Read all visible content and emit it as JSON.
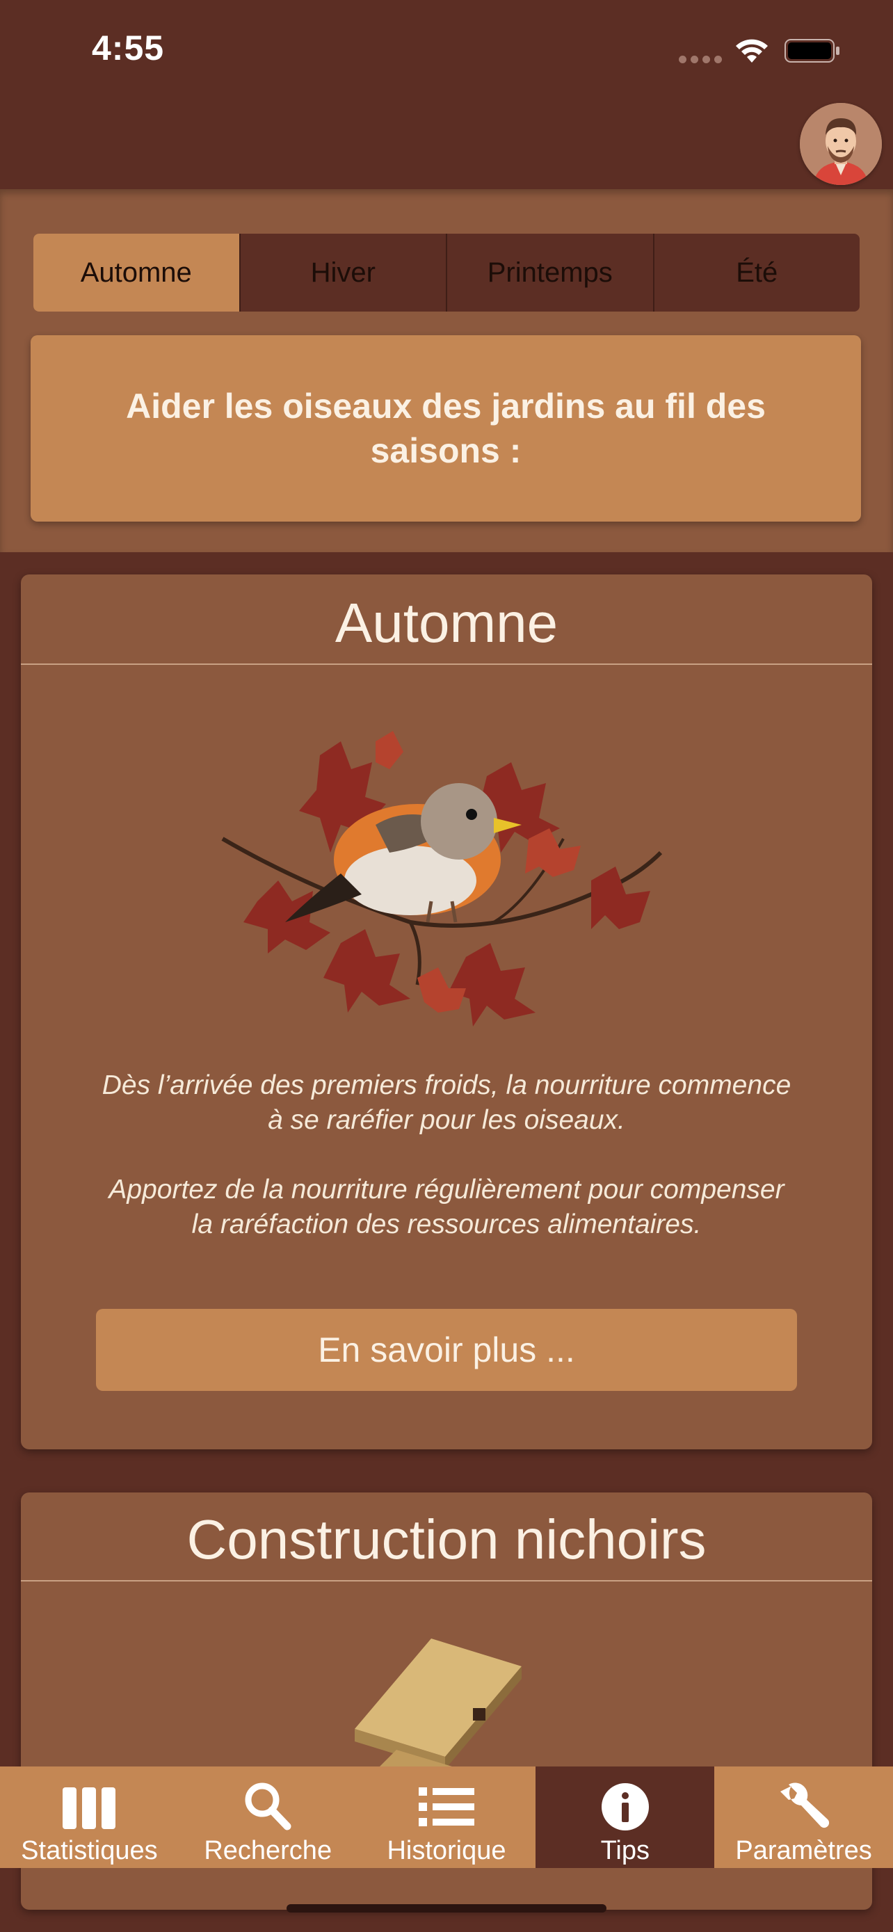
{
  "status_bar": {
    "time": "4:55"
  },
  "seasons": {
    "tabs": [
      "Automne",
      "Hiver",
      "Printemps",
      "Été"
    ],
    "selected": "Automne"
  },
  "intro": {
    "title": "Aider les oiseaux des jardins au fil des saisons :"
  },
  "autumn_card": {
    "title": "Automne",
    "paragraph1": "Dès l’arrivée des premiers froids, la nourriture commence à se raréfier pour les oiseaux.",
    "paragraph2": "Apportez de la nourriture régulièrement pour compenser la raréfaction des ressources alimentaires.",
    "button_label": "En savoir plus ..."
  },
  "nest_card": {
    "title": "Construction nichoirs"
  },
  "tab_bar": {
    "items": [
      {
        "label": "Statistiques",
        "icon": "bars-icon"
      },
      {
        "label": "Recherche",
        "icon": "search-icon"
      },
      {
        "label": "Historique",
        "icon": "list-icon"
      },
      {
        "label": "Tips",
        "icon": "info-icon"
      },
      {
        "label": "Paramètres",
        "icon": "wrench-icon"
      }
    ],
    "selected": "Tips"
  },
  "colors": {
    "header_bg": "#5c2e24",
    "panel_bg": "#8c593e",
    "accent": "#c48754",
    "text_light": "#fbf1e4"
  }
}
